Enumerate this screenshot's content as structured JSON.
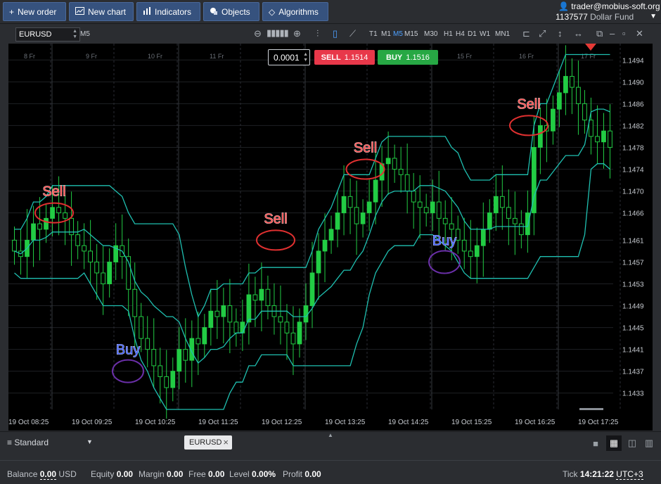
{
  "toolbar": {
    "new_order": "New order",
    "new_chart": "New chart",
    "indicators": "Indicators",
    "objects": "Objects",
    "algorithms": "Algorithms"
  },
  "account": {
    "email": "trader@mobius-soft.org",
    "number": "1137577",
    "fund": "Dollar Fund"
  },
  "chart_toolbar": {
    "symbol": "EURUSD",
    "timeframe": "M5",
    "timeframes": [
      "T1",
      "M1",
      "M5",
      "M15",
      "M30",
      "H1",
      "H4",
      "D1",
      "W1",
      "MN1"
    ],
    "active_timeframe": "M5"
  },
  "trade": {
    "quantity": "0.0001",
    "sell_label": "SELL",
    "sell_price": "1.1514",
    "buy_label": "BUY",
    "buy_price": "1.1516"
  },
  "chart_data": {
    "type": "candlestick",
    "symbol": "EURUSD",
    "timeframe": "M5",
    "top_date_labels": [
      "8 Fr",
      "9 Fr",
      "10 Fr",
      "11 Fr",
      "12 Fr",
      "13 Fr",
      "14 Fr",
      "15 Fr",
      "16 Fr",
      "17 Fr"
    ],
    "x_tick_labels": [
      "19 Oct 08:25",
      "19 Oct 09:25",
      "19 Oct 10:25",
      "19 Oct 11:25",
      "19 Oct 12:25",
      "19 Oct 13:25",
      "19 Oct 14:25",
      "19 Oct 15:25",
      "19 Oct 16:25",
      "19 Oct 17:25"
    ],
    "y_tick_labels": [
      "1.1494",
      "1.1490",
      "1.1486",
      "1.1482",
      "1.1478",
      "1.1474",
      "1.1470",
      "1.1466",
      "1.1461",
      "1.1457",
      "1.1453",
      "1.1449",
      "1.1445",
      "1.1441",
      "1.1437",
      "1.1433"
    ],
    "ylim": [
      1.143,
      1.1497
    ],
    "candles_close": [
      1.1459,
      1.1458,
      1.1461,
      1.1464,
      1.1463,
      1.1465,
      1.1467,
      1.1466,
      1.1465,
      1.1462,
      1.146,
      1.1459,
      1.1457,
      1.1455,
      1.1453,
      1.1457,
      1.146,
      1.1458,
      1.1452,
      1.1447,
      1.1443,
      1.1441,
      1.1438,
      1.1436,
      1.1434,
      1.1437,
      1.1441,
      1.1439,
      1.1443,
      1.1442,
      1.1445,
      1.1448,
      1.1447,
      1.1449,
      1.1446,
      1.1444,
      1.1446,
      1.1451,
      1.145,
      1.1452,
      1.1449,
      1.1447,
      1.1446,
      1.1444,
      1.1442,
      1.1446,
      1.1449,
      1.1455,
      1.1459,
      1.1461,
      1.1463,
      1.1466,
      1.1469,
      1.1467,
      1.1464,
      1.1466,
      1.1468,
      1.1472,
      1.1475,
      1.1476,
      1.1474,
      1.1473,
      1.147,
      1.1468,
      1.1467,
      1.1466,
      1.1468,
      1.1465,
      1.1464,
      1.1463,
      1.1461,
      1.1459,
      1.1458,
      1.146,
      1.1463,
      1.1466,
      1.1469,
      1.1467,
      1.1465,
      1.1464,
      1.1462,
      1.1466,
      1.1478,
      1.1482,
      1.1481,
      1.1485,
      1.1488,
      1.1491,
      1.1489,
      1.1486,
      1.1483,
      1.148,
      1.1479,
      1.1481,
      1.1478
    ],
    "series": [
      {
        "name": "Upper band",
        "color": "#1fbfb0"
      },
      {
        "name": "Middle band",
        "color": "#1fbfb0"
      },
      {
        "name": "Lower band",
        "color": "#1fbfb0"
      }
    ],
    "annotations": [
      {
        "text": "Sell",
        "color": "#ff4a4a",
        "x_time": "19 Oct 08:55",
        "y": 1.1466
      },
      {
        "text": "Buy",
        "color": "#3d5cff",
        "x_time": "19 Oct 10:05",
        "y": 1.1437
      },
      {
        "text": "Sell",
        "color": "#ff4a4a",
        "x_time": "19 Oct 12:25",
        "y": 1.1461
      },
      {
        "text": "Sell",
        "color": "#ff4a4a",
        "x_time": "19 Oct 13:50",
        "y": 1.1474
      },
      {
        "text": "Buy",
        "color": "#3d5cff",
        "x_time": "19 Oct 15:05",
        "y": 1.1457
      },
      {
        "text": "Sell",
        "color": "#ff4a4a",
        "x_time": "19 Oct 16:25",
        "y": 1.1482
      }
    ]
  },
  "tabs_bar": {
    "layout": "Standard",
    "tab_label": "EURUSD"
  },
  "status": {
    "balance_label": "Balance",
    "balance_value": "0.00",
    "balance_currency": "USD",
    "equity_label": "Equity",
    "equity_value": "0.00",
    "margin_label": "Margin",
    "margin_value": "0.00",
    "free_label": "Free",
    "free_value": "0.00",
    "level_label": "Level",
    "level_value": "0.00%",
    "profit_label": "Profit",
    "profit_value": "0.00",
    "tick_label": "Tick",
    "time": "14:21:22",
    "timezone": "UTC+3"
  },
  "colors": {
    "toolbar_button": "#36527e",
    "sell": "#e8384a",
    "buy": "#27a844",
    "candle": "#22cc44",
    "band": "#1fbfb0"
  }
}
